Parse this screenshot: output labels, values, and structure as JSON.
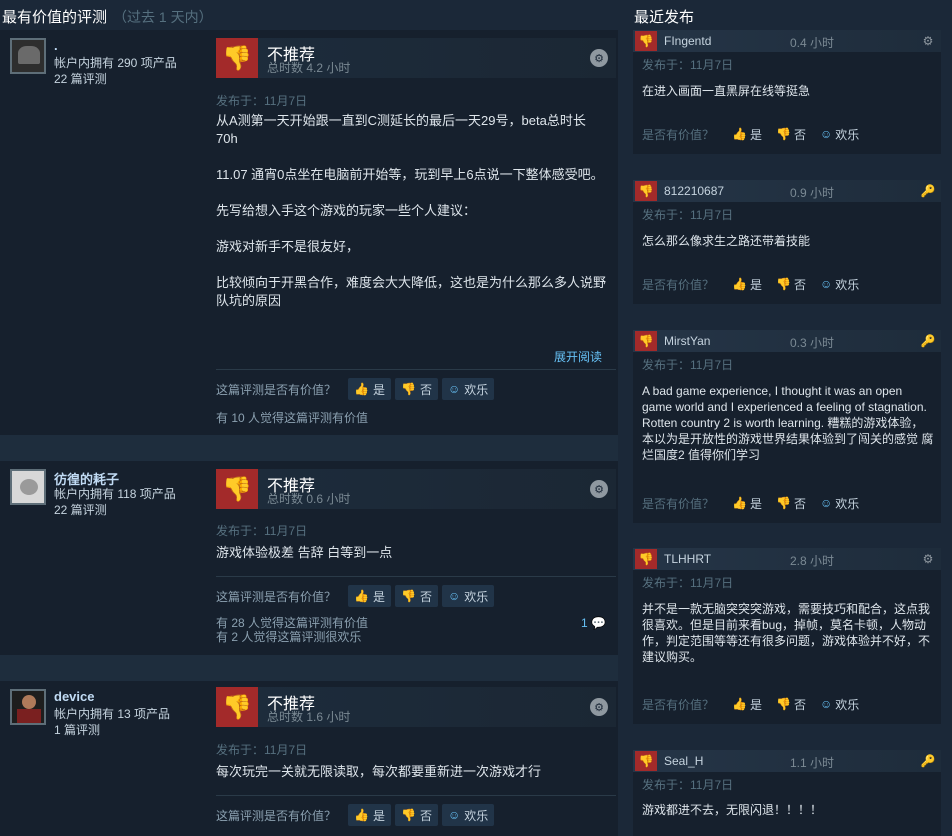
{
  "title": {
    "main": "最有价值的评测",
    "sub": "（过去 1 天内）"
  },
  "side_title": "最近发布",
  "reviews": [
    {
      "name": ".",
      "products": "帐户内拥有 290 项产品",
      "reviews": "22 篇评测",
      "rec": "不推荐",
      "hours": "总时数 4.2 小时",
      "posted": "发布于：11月7日",
      "body": "从A测第一天开始跟一直到C测延长的最后一天29号，beta总时长70h\n\n11.07 通宵0点坐在电脑前开始等，玩到早上6点说一下整体感受吧。\n\n先写给想入手这个游戏的玩家一些个人建议：\n\n游戏对新手不是很友好，\n\n比较倾向于开黑合作，难度会大大降低，这也是为什么那么多人说野队坑的原因",
      "expand": "展开阅读",
      "helpful_q": "这篇评测是否有价值？",
      "yes": "是",
      "no": "否",
      "funny": "欢乐",
      "found": "有 10 人觉得这篇评测有价值",
      "found2": "",
      "comments": ""
    },
    {
      "name": "彷徨的耗子",
      "products": "帐户内拥有 118 项产品",
      "reviews": "22 篇评测",
      "rec": "不推荐",
      "hours": "总时数 0.6 小时",
      "posted": "发布于：11月7日",
      "body": "游戏体验极差 告辞 白等到一点",
      "expand": "",
      "helpful_q": "这篇评测是否有价值？",
      "yes": "是",
      "no": "否",
      "funny": "欢乐",
      "found": "有 28 人觉得这篇评测有价值",
      "found2": "有 2 人觉得这篇评测很欢乐",
      "comments": "1"
    },
    {
      "name": "device",
      "products": "帐户内拥有 13 项产品",
      "reviews": "1 篇评测",
      "rec": "不推荐",
      "hours": "总时数 1.6 小时",
      "posted": "发布于：11月7日",
      "body": "每次玩完一关就无限读取，每次都要重新进一次游戏才行",
      "expand": "",
      "helpful_q": "这篇评测是否有价值？",
      "yes": "是",
      "no": "否",
      "funny": "欢乐",
      "found": "",
      "found2": "",
      "comments": ""
    }
  ],
  "recent": [
    {
      "name": "FIngentd",
      "hours": "0.4 小时",
      "posted": "发布于：11月7日",
      "text": "在进入画面一直黑屏在线等挺急",
      "helpful_q": "是否有价值？",
      "yes": "是",
      "no": "否",
      "funny": "欢乐",
      "icon": "steam-icon"
    },
    {
      "name": "812210687",
      "hours": "0.9 小时",
      "posted": "发布于：11月7日",
      "text": "怎么那么像求生之路还带着技能",
      "helpful_q": "是否有价值？",
      "yes": "是",
      "no": "否",
      "funny": "欢乐",
      "icon": "key-icon"
    },
    {
      "name": "MirstYan",
      "hours": "0.3 小时",
      "posted": "发布于：11月7日",
      "text": "A bad game experience, I thought it was an open game world and I experienced a feeling of stagnation. Rotten country 2 is worth learning. 糟糕的游戏体验，本以为是开放性的游戏世界结果体验到了闯关的感觉 腐烂国度2 值得你们学习",
      "helpful_q": "是否有价值？",
      "yes": "是",
      "no": "否",
      "funny": "欢乐",
      "icon": "key-icon"
    },
    {
      "name": "TLHHRT",
      "hours": "2.8 小时",
      "posted": "发布于：11月7日",
      "text": "并不是一款无脑突突突游戏，需要技巧和配合，这点我很喜欢。但是目前来看bug，掉帧，莫名卡顿，人物动作，判定范围等等还有很多问题，游戏体验并不好，不建议购买。",
      "helpful_q": "是否有价值？",
      "yes": "是",
      "no": "否",
      "funny": "欢乐",
      "icon": "steam-icon"
    },
    {
      "name": "Seal_H",
      "hours": "1.1 小时",
      "posted": "发布于：11月7日",
      "text": "游戏都进不去，无限闪退！！！！",
      "helpful_q": "",
      "yes": "",
      "no": "",
      "funny": "",
      "icon": "key-icon"
    }
  ]
}
